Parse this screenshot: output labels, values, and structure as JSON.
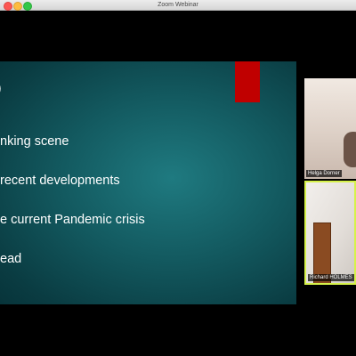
{
  "window": {
    "title": "Zoom Webinar"
  },
  "slide": {
    "partial_heading": ")",
    "bullets": [
      "nking scene",
      "recent developments",
      "e current Pandemic crisis",
      "ead"
    ],
    "accent_color": "#c00000",
    "background_color": "#135a60"
  },
  "participants": [
    {
      "name": "Helga Dorner",
      "active_speaker": false
    },
    {
      "name": "Richard HOLMES",
      "active_speaker": true,
      "highlight_color": "#d6f24a"
    }
  ]
}
